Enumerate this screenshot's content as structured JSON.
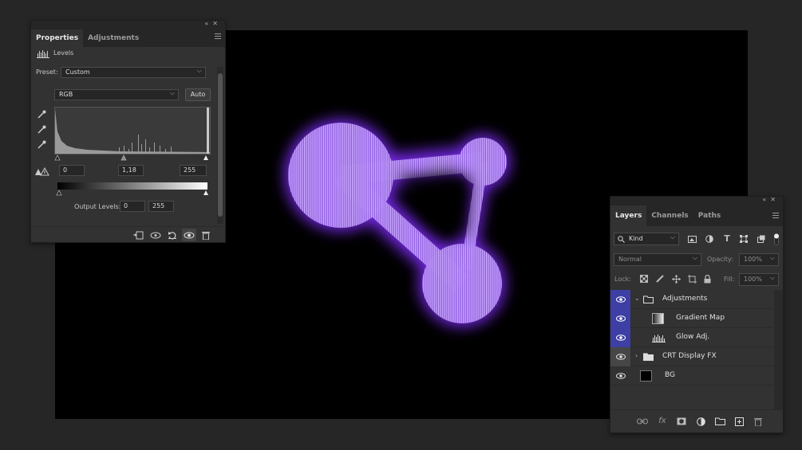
{
  "properties": {
    "tabs": [
      "Properties",
      "Adjustments"
    ],
    "active_tab": "Properties",
    "adjustment_name": "Levels",
    "preset_label": "Preset:",
    "preset_value": "Custom",
    "channel_value": "RGB",
    "auto_label": "Auto",
    "input_black": "0",
    "input_mid": "1,18",
    "input_white": "255",
    "output_label": "Output Levels:",
    "output_black": "0",
    "output_white": "255"
  },
  "layers": {
    "tabs": [
      "Layers",
      "Channels",
      "Paths"
    ],
    "active_tab": "Layers",
    "filter_value": "Kind",
    "blend_mode": "Normal",
    "opacity_label": "Opacity:",
    "opacity_value": "100%",
    "lock_label": "Lock:",
    "fill_label": "Fill:",
    "fill_value": "100%",
    "items": [
      {
        "name": "Adjustments",
        "type": "group",
        "expanded": true,
        "selected": true
      },
      {
        "name": "Gradient Map",
        "type": "gradient-map",
        "selected": true
      },
      {
        "name": "Glow Adj.",
        "type": "levels",
        "selected": true
      },
      {
        "name": "CRT Display FX",
        "type": "group",
        "expanded": false,
        "selected": false
      },
      {
        "name": "BG",
        "type": "pixel",
        "selected": false
      }
    ]
  },
  "colors": {
    "glow": "#9b4dff",
    "selection": "#3d3fa4",
    "panel": "#323232",
    "workspace": "#262626"
  }
}
